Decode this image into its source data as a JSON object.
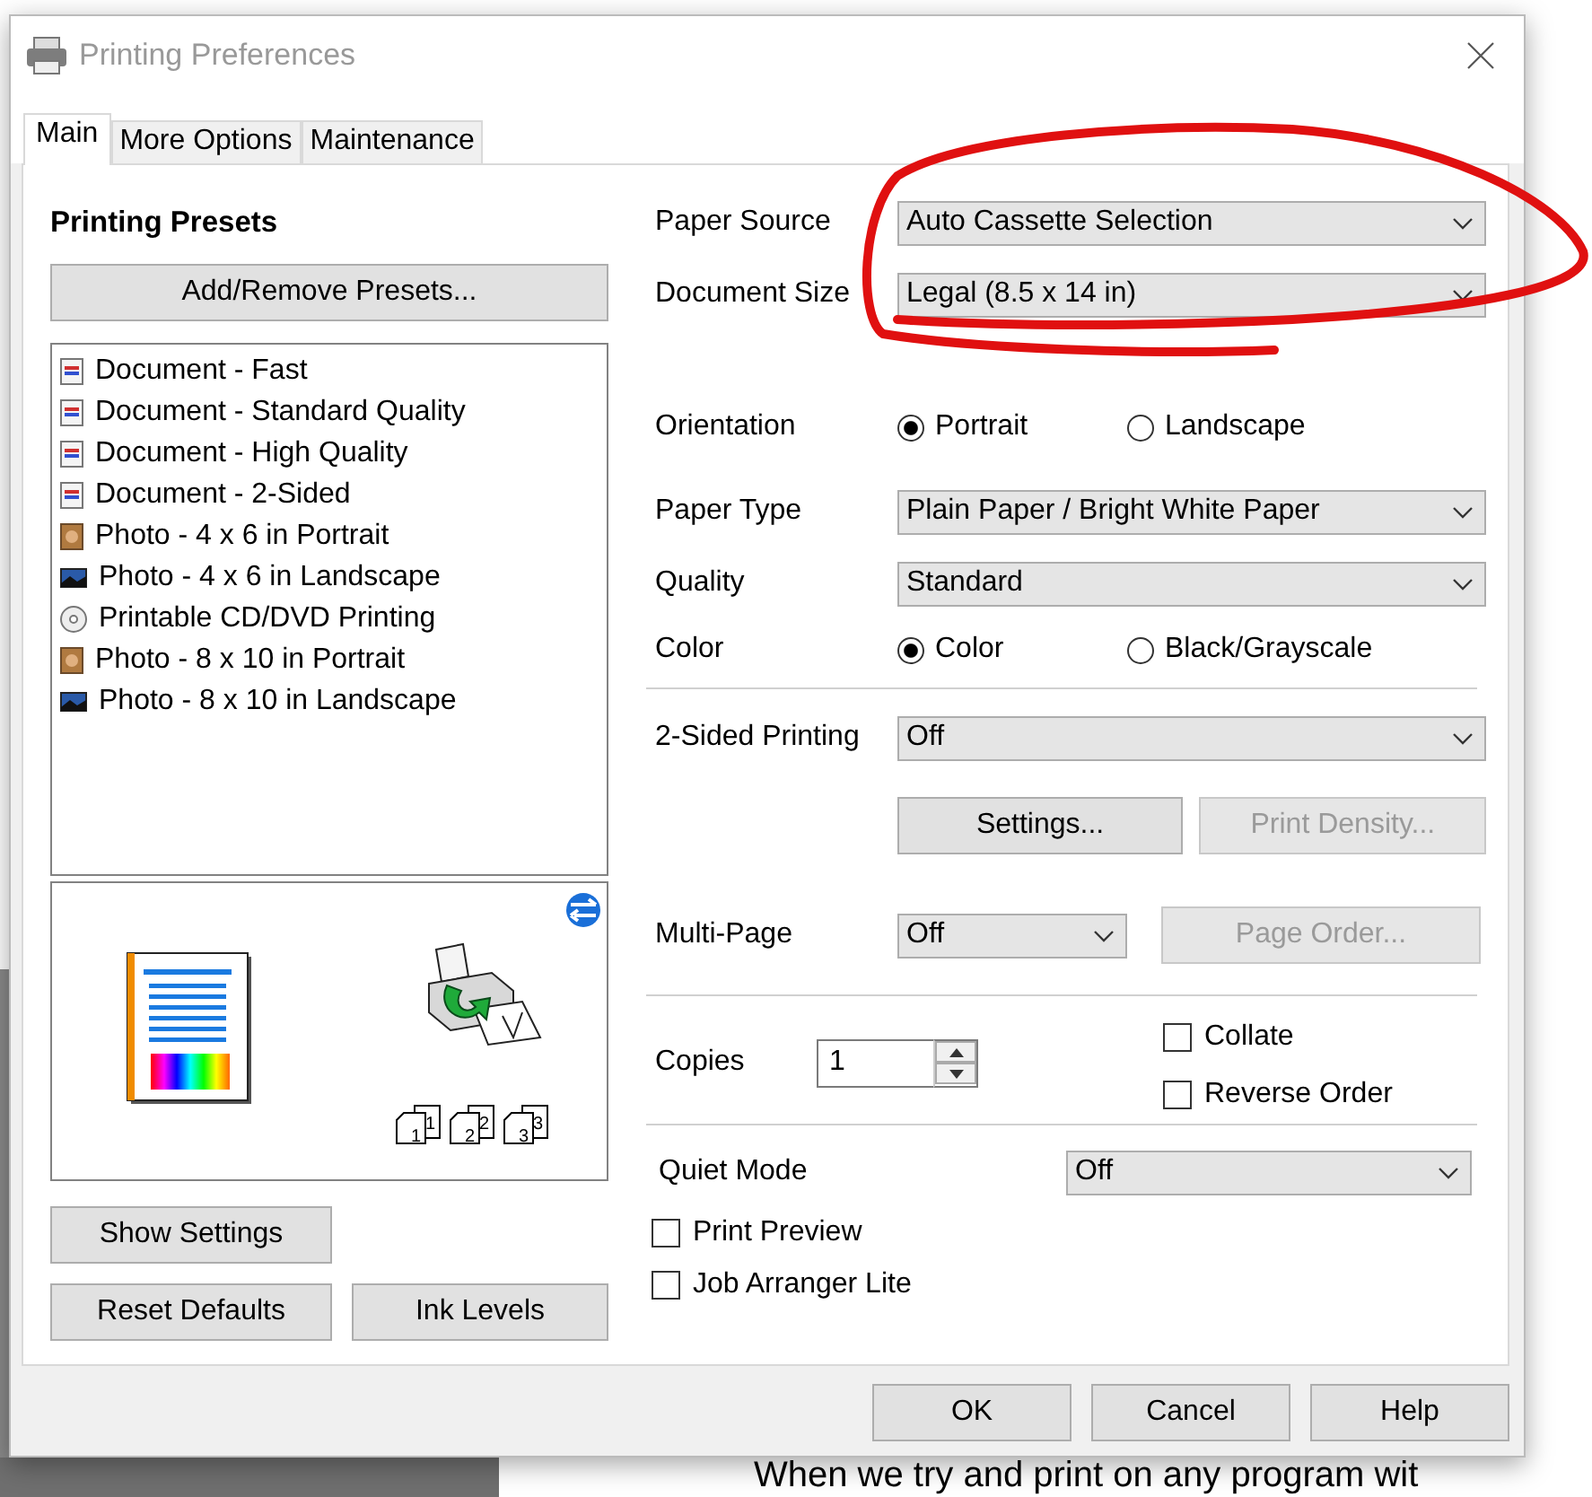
{
  "window": {
    "title": "Printing Preferences"
  },
  "tabs": [
    {
      "label": "Main",
      "selected": true
    },
    {
      "label": "More Options",
      "selected": false
    },
    {
      "label": "Maintenance",
      "selected": false
    }
  ],
  "presets": {
    "title": "Printing Presets",
    "button": "Add/Remove Presets...",
    "items": [
      {
        "label": "Document - Fast",
        "kind": "document"
      },
      {
        "label": "Document - Standard Quality",
        "kind": "document"
      },
      {
        "label": "Document - High Quality",
        "kind": "document"
      },
      {
        "label": "Document - 2-Sided",
        "kind": "document"
      },
      {
        "label": "Photo - 4 x 6 in Portrait",
        "kind": "photo"
      },
      {
        "label": "Photo - 4 x 6 in Landscape",
        "kind": "landscape"
      },
      {
        "label": "Printable CD/DVD Printing",
        "kind": "disc"
      },
      {
        "label": "Photo - 8 x 10 in Portrait",
        "kind": "photo"
      },
      {
        "label": "Photo - 8 x 10 in Landscape",
        "kind": "landscape"
      }
    ]
  },
  "preview": {
    "page_order_icons": [
      {
        "back": "1",
        "front": "1"
      },
      {
        "back": "2",
        "front": "2"
      },
      {
        "back": "3",
        "front": "3"
      }
    ]
  },
  "left_buttons": [
    {
      "label": "Show Settings"
    },
    {
      "label": "Reset Defaults"
    },
    {
      "label": "Ink Levels"
    }
  ],
  "paper_source": {
    "label": "Paper Source",
    "value": "Auto Cassette Selection"
  },
  "document_size": {
    "label": "Document Size",
    "value": "Legal (8.5 x 14 in)"
  },
  "orientation": {
    "label": "Orientation",
    "options": [
      {
        "label": "Portrait",
        "selected": true
      },
      {
        "label": "Landscape",
        "selected": false
      }
    ]
  },
  "paper_type": {
    "label": "Paper Type",
    "value": "Plain Paper / Bright White Paper"
  },
  "quality": {
    "label": "Quality",
    "value": "Standard"
  },
  "color": {
    "label": "Color",
    "options": [
      {
        "label": "Color",
        "selected": true
      },
      {
        "label": "Black/Grayscale",
        "selected": false
      }
    ]
  },
  "two_sided": {
    "label": "2-Sided Printing",
    "value": "Off"
  },
  "two_sided_buttons": [
    {
      "label": "Settings...",
      "disabled": false
    },
    {
      "label": "Print Density...",
      "disabled": true
    }
  ],
  "multi_page": {
    "label": "Multi-Page",
    "value": "Off"
  },
  "page_order_button": {
    "label": "Page Order...",
    "disabled": true
  },
  "copies": {
    "label": "Copies",
    "value": "1"
  },
  "collate": {
    "label": "Collate",
    "checked": false
  },
  "reverse_order": {
    "label": "Reverse Order",
    "checked": false
  },
  "quiet_mode": {
    "label": "Quiet Mode",
    "value": "Off"
  },
  "print_preview": {
    "label": "Print Preview",
    "checked": false
  },
  "job_arranger_lite": {
    "label": "Job Arranger Lite",
    "checked": false
  },
  "footer_buttons": [
    {
      "label": "OK"
    },
    {
      "label": "Cancel"
    },
    {
      "label": "Help"
    }
  ],
  "background_text": "When we try and print on any program wit"
}
